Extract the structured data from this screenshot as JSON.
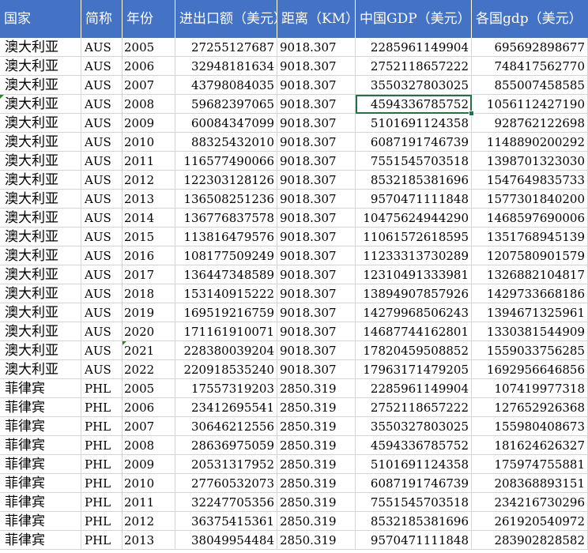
{
  "headers": {
    "country": "国家",
    "abbr": "简称",
    "year": "年份",
    "trade": "进出口额（美元）",
    "distance": "距离（KM）",
    "china_gdp": "中国GDP（美元）",
    "country_gdp": "各国gdp（美元）"
  },
  "selected_cell": "D4",
  "rows": [
    {
      "country": "澳大利亚",
      "abbr": "AUS",
      "year": "2005",
      "trade": "27255127687",
      "distance": "9018.307",
      "china_gdp": "2285961149904",
      "country_gdp": "695692898677"
    },
    {
      "country": "澳大利亚",
      "abbr": "AUS",
      "year": "2006",
      "trade": "32948181634",
      "distance": "9018.307",
      "china_gdp": "2752118657222",
      "country_gdp": "748417562770"
    },
    {
      "country": "澳大利亚",
      "abbr": "AUS",
      "year": "2007",
      "trade": "43798084035",
      "distance": "9018.307",
      "china_gdp": "3550327803025",
      "country_gdp": "855007458585"
    },
    {
      "country": "澳大利亚",
      "abbr": "AUS",
      "year": "2008",
      "trade": "59682397065",
      "distance": "9018.307",
      "china_gdp": "4594336785752",
      "country_gdp": "1056112427190"
    },
    {
      "country": "澳大利亚",
      "abbr": "AUS",
      "year": "2009",
      "trade": "60084347099",
      "distance": "9018.307",
      "china_gdp": "5101691124358",
      "country_gdp": "928762122698"
    },
    {
      "country": "澳大利亚",
      "abbr": "AUS",
      "year": "2010",
      "trade": "88325432010",
      "distance": "9018.307",
      "china_gdp": "6087191746739",
      "country_gdp": "1148890200292"
    },
    {
      "country": "澳大利亚",
      "abbr": "AUS",
      "year": "2011",
      "trade": "116577490066",
      "distance": "9018.307",
      "china_gdp": "7551545703518",
      "country_gdp": "1398701323030"
    },
    {
      "country": "澳大利亚",
      "abbr": "AUS",
      "year": "2012",
      "trade": "122303128126",
      "distance": "9018.307",
      "china_gdp": "8532185381696",
      "country_gdp": "1547649835733"
    },
    {
      "country": "澳大利亚",
      "abbr": "AUS",
      "year": "2013",
      "trade": "136508251236",
      "distance": "9018.307",
      "china_gdp": "9570471111848",
      "country_gdp": "1577301840200"
    },
    {
      "country": "澳大利亚",
      "abbr": "AUS",
      "year": "2014",
      "trade": "136776837578",
      "distance": "9018.307",
      "china_gdp": "10475624944290",
      "country_gdp": "1468597690006"
    },
    {
      "country": "澳大利亚",
      "abbr": "AUS",
      "year": "2015",
      "trade": "113816479576",
      "distance": "9018.307",
      "china_gdp": "11061572618595",
      "country_gdp": "1351768945139"
    },
    {
      "country": "澳大利亚",
      "abbr": "AUS",
      "year": "2016",
      "trade": "108177509249",
      "distance": "9018.307",
      "china_gdp": "11233313730289",
      "country_gdp": "1207580901579"
    },
    {
      "country": "澳大利亚",
      "abbr": "AUS",
      "year": "2017",
      "trade": "136447348589",
      "distance": "9018.307",
      "china_gdp": "12310491333981",
      "country_gdp": "1326882104817"
    },
    {
      "country": "澳大利亚",
      "abbr": "AUS",
      "year": "2018",
      "trade": "153140915222",
      "distance": "9018.307",
      "china_gdp": "13894907857926",
      "country_gdp": "1429733668186"
    },
    {
      "country": "澳大利亚",
      "abbr": "AUS",
      "year": "2019",
      "trade": "169519216759",
      "distance": "9018.307",
      "china_gdp": "14279968506243",
      "country_gdp": "1394671325961"
    },
    {
      "country": "澳大利亚",
      "abbr": "AUS",
      "year": "2020",
      "trade": "171161910071",
      "distance": "9018.307",
      "china_gdp": "14687744162801",
      "country_gdp": "1330381544909"
    },
    {
      "country": "澳大利亚",
      "abbr": "AUS",
      "year": "2021",
      "trade": "228380039204",
      "distance": "9018.307",
      "china_gdp": "17820459508852",
      "country_gdp": "1559033756285"
    },
    {
      "country": "澳大利亚",
      "abbr": "AUS",
      "year": "2022",
      "trade": "220918535240",
      "distance": "9018.307",
      "china_gdp": "17963171479205",
      "country_gdp": "1692956646856"
    },
    {
      "country": "菲律宾",
      "abbr": "PHL",
      "year": "2005",
      "trade": "17557319203",
      "distance": "2850.319",
      "china_gdp": "2285961149904",
      "country_gdp": "107419977318"
    },
    {
      "country": "菲律宾",
      "abbr": "PHL",
      "year": "2006",
      "trade": "23412695541",
      "distance": "2850.319",
      "china_gdp": "2752118657222",
      "country_gdp": "127652926368"
    },
    {
      "country": "菲律宾",
      "abbr": "PHL",
      "year": "2007",
      "trade": "30646212556",
      "distance": "2850.319",
      "china_gdp": "3550327803025",
      "country_gdp": "155980408673"
    },
    {
      "country": "菲律宾",
      "abbr": "PHL",
      "year": "2008",
      "trade": "28636975059",
      "distance": "2850.319",
      "china_gdp": "4594336785752",
      "country_gdp": "181624626327"
    },
    {
      "country": "菲律宾",
      "abbr": "PHL",
      "year": "2009",
      "trade": "20531317952",
      "distance": "2850.319",
      "china_gdp": "5101691124358",
      "country_gdp": "175974755881"
    },
    {
      "country": "菲律宾",
      "abbr": "PHL",
      "year": "2010",
      "trade": "27760532073",
      "distance": "2850.319",
      "china_gdp": "6087191746739",
      "country_gdp": "208368893151"
    },
    {
      "country": "菲律宾",
      "abbr": "PHL",
      "year": "2011",
      "trade": "32247705356",
      "distance": "2850.319",
      "china_gdp": "7551545703518",
      "country_gdp": "234216730296"
    },
    {
      "country": "菲律宾",
      "abbr": "PHL",
      "year": "2012",
      "trade": "36375415361",
      "distance": "2850.319",
      "china_gdp": "8532185381696",
      "country_gdp": "261920540972"
    },
    {
      "country": "菲律宾",
      "abbr": "PHL",
      "year": "2013",
      "trade": "38049954484",
      "distance": "2850.319",
      "china_gdp": "9570471111848",
      "country_gdp": "283902828582"
    }
  ]
}
